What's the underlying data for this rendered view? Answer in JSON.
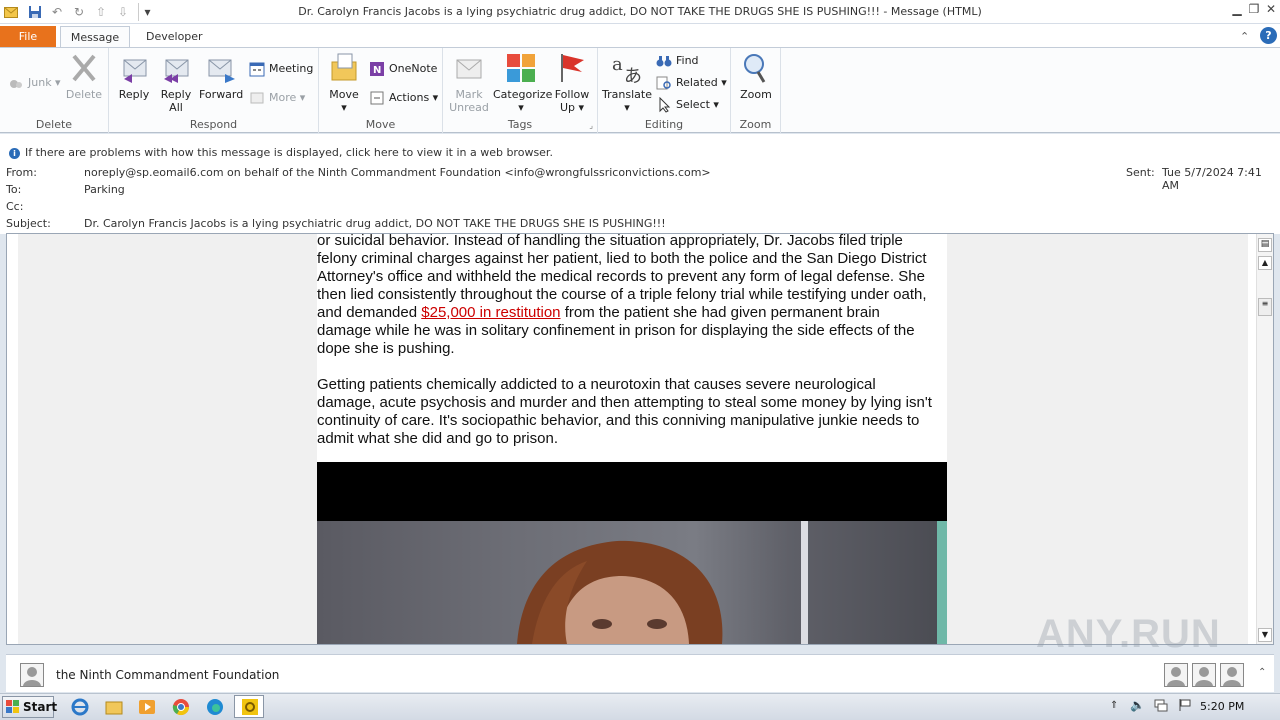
{
  "window": {
    "title": "Dr. Carolyn Francis Jacobs is a lying psychiatric drug addict, DO NOT TAKE THE DRUGS SHE IS PUSHING!!!  -  Message (HTML)"
  },
  "tabs": {
    "file": "File",
    "message": "Message",
    "developer": "Developer"
  },
  "ribbon": {
    "delete": {
      "label": "Delete",
      "junk": "Junk",
      "delete": "Delete"
    },
    "respond": {
      "label": "Respond",
      "reply": "Reply",
      "reply_all_1": "Reply",
      "reply_all_2": "All",
      "forward": "Forward",
      "meeting": "Meeting",
      "more": "More"
    },
    "move": {
      "label": "Move",
      "move": "Move",
      "onenote": "OneNote",
      "actions": "Actions"
    },
    "tags": {
      "label": "Tags",
      "mark_unread_1": "Mark",
      "mark_unread_2": "Unread",
      "categorize": "Categorize",
      "follow_up_1": "Follow",
      "follow_up_2": "Up"
    },
    "editing": {
      "label": "Editing",
      "translate": "Translate",
      "find": "Find",
      "related": "Related",
      "select": "Select"
    },
    "zoom": {
      "label": "Zoom",
      "zoom": "Zoom"
    }
  },
  "infobar": {
    "message": "If there are problems with how this message is displayed, click here to view it in a web browser."
  },
  "header": {
    "from_label": "From:",
    "from": "noreply@sp.eomail6.com on behalf of the Ninth Commandment Foundation <info@wrongfulssriconvictions.com>",
    "to_label": "To:",
    "to": "Parking",
    "cc_label": "Cc:",
    "cc": "",
    "subject_label": "Subject:",
    "subject": "Dr. Carolyn Francis Jacobs is a lying psychiatric drug addict, DO NOT TAKE THE DRUGS SHE IS PUSHING!!!",
    "sent_label": "Sent:",
    "sent": "Tue 5/7/2024 7:41 AM"
  },
  "body": {
    "p1_before": "or suicidal behavior. Instead of handling the situation appropriately, Dr. Jacobs filed triple felony criminal charges against her patient, lied to both the police and the San Diego District Attorney's office and withheld the medical records to prevent any form of legal defense. She then lied consistently throughout the course of a triple felony trial while testifying under oath, and demanded ",
    "p1_link": "$25,000 in restitution",
    "p1_after": " from the patient she had given permanent brain damage while he was in solitary confinement in prison for displaying the side effects of the dope she is pushing.",
    "p2": "Getting patients chemically addicted to a neurotoxin that causes severe neurological damage, acute psychosis and murder and then attempting to steal some money by lying isn't continuity of care. It's sociopathic behavior, and this conniving manipulative junkie needs to admit what she did and go to prison."
  },
  "people_pane": {
    "name": "the Ninth Commandment Foundation"
  },
  "taskbar": {
    "start": "Start",
    "clock": "5:20 PM"
  },
  "watermark": "ANY.RUN"
}
